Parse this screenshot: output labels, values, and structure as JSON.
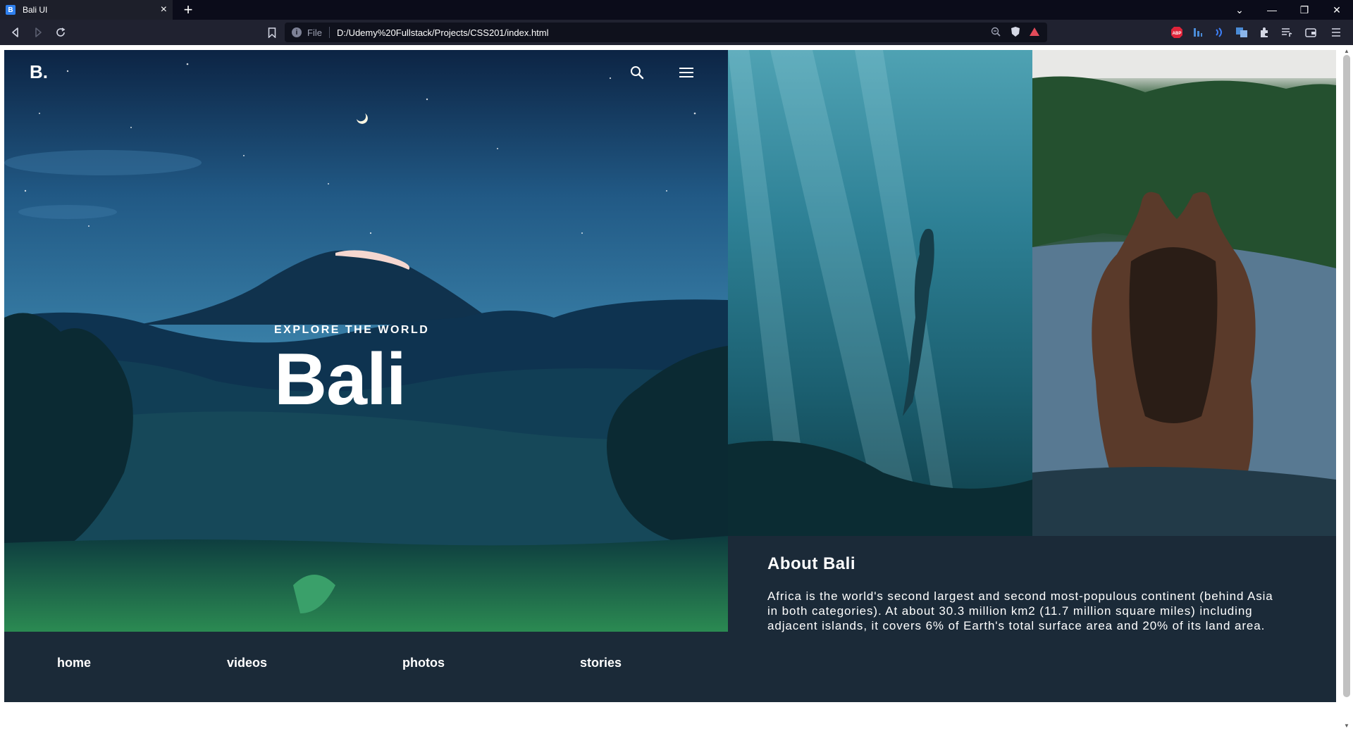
{
  "browser": {
    "tab_favicon": "B",
    "tab_title": "Bali UI",
    "tab_close": "×",
    "new_tab": "+",
    "url_scheme": "File",
    "url": "D:/Udemy%20Fullstack/Projects/CSS201/index.html",
    "window_controls": [
      "⌄",
      "—",
      "❐",
      "✕"
    ]
  },
  "hero": {
    "logo": "B.",
    "tagline": "EXPLORE THE WORLD",
    "headline": "Bali",
    "icons": [
      "search-icon",
      "menu-icon"
    ]
  },
  "nav": {
    "items": [
      {
        "label": "home"
      },
      {
        "label": "videos"
      },
      {
        "label": "photos"
      },
      {
        "label": "stories"
      }
    ]
  },
  "about": {
    "title": "About Bali",
    "body": "Africa is the world's second largest and second most-populous continent (behind Asia in both categories). At about 30.3 million km2 (11.7 million square miles) including adjacent islands, it covers 6% of Earth's total surface area and 20% of its land area."
  },
  "colors": {
    "browser_tabbar": "#0b0c1a",
    "browser_toolbar": "#202230",
    "page_panel": "#1b2a38",
    "text": "#ffffff"
  }
}
